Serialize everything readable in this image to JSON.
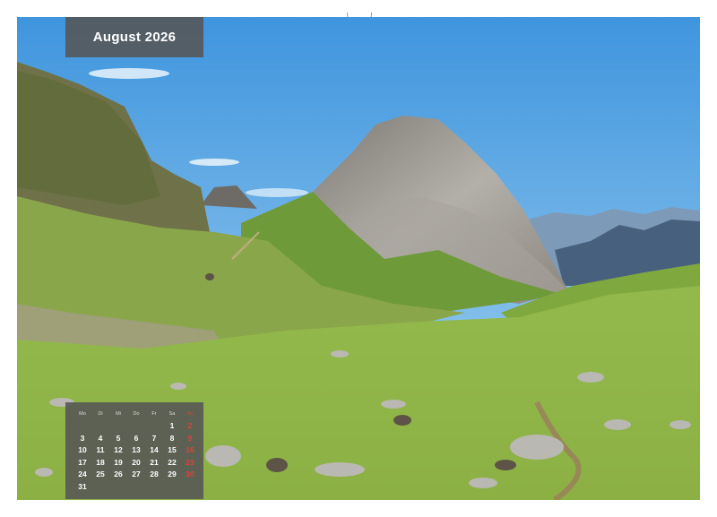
{
  "calendar_page": {
    "month_title": "August 2026",
    "weekdays": [
      "Mo",
      "Di",
      "Mi",
      "Do",
      "Fr",
      "Sa",
      "So"
    ],
    "weeks": [
      [
        "",
        "",
        "",
        "",
        "",
        "1",
        "2"
      ],
      [
        "3",
        "4",
        "5",
        "6",
        "7",
        "8",
        "9"
      ],
      [
        "10",
        "11",
        "12",
        "13",
        "14",
        "15",
        "16"
      ],
      [
        "17",
        "18",
        "19",
        "20",
        "21",
        "22",
        "23"
      ],
      [
        "24",
        "25",
        "26",
        "27",
        "28",
        "29",
        "30"
      ],
      [
        "31",
        "",
        "",
        "",
        "",
        "",
        ""
      ]
    ]
  },
  "photo": {
    "subject": "mountain-meadow-landscape",
    "colors": {
      "sky": "#4fa2e3",
      "meadow": "#8fb548",
      "rock": "#9c9a94",
      "label_bg": "#555555",
      "sunday": "#e0423a"
    }
  }
}
